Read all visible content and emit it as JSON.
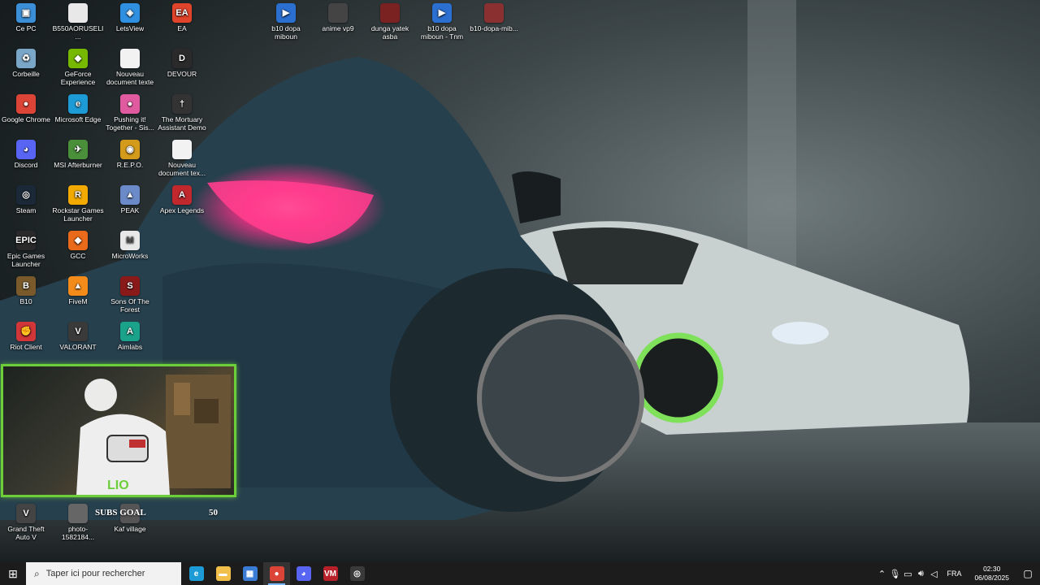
{
  "desktop_icons": [
    {
      "label": "Ce PC",
      "icon": "computer-icon",
      "color": "#3b8fd9",
      "glyph": "▣"
    },
    {
      "label": "B550AORUSELI...",
      "icon": "document-icon",
      "color": "#e8e8e8",
      "glyph": ""
    },
    {
      "label": "LetsView",
      "icon": "letsview-icon",
      "color": "#2f8fe0",
      "glyph": "◈"
    },
    {
      "label": "EA",
      "icon": "ea-icon",
      "color": "#e0442b",
      "glyph": "EA"
    },
    {
      "label": "b10 dopa miboun",
      "icon": "video-file-icon",
      "color": "#2b6fd0",
      "glyph": "▶"
    },
    {
      "label": "anime vp9",
      "icon": "image-file-icon",
      "color": "#444",
      "glyph": ""
    },
    {
      "label": "dunga yatek asba",
      "icon": "image-file-icon",
      "color": "#7a2222",
      "glyph": ""
    },
    {
      "label": "b10 dopa miboun - Tnm",
      "icon": "video-file-icon",
      "color": "#2b6fd0",
      "glyph": "▶"
    },
    {
      "label": "b10-dopa-mib...",
      "icon": "image-file-icon",
      "color": "#8a3030",
      "glyph": ""
    },
    {
      "label": "Corbeille",
      "icon": "recycle-bin-icon",
      "color": "#7aa6c8",
      "glyph": "♻"
    },
    {
      "label": "GeForce Experience",
      "icon": "geforce-icon",
      "color": "#76b900",
      "glyph": "◆"
    },
    {
      "label": "Nouveau document texte",
      "icon": "text-file-icon",
      "color": "#f2f2f2",
      "glyph": ""
    },
    {
      "label": "DEVOUR",
      "icon": "devour-icon",
      "color": "#2a2a2a",
      "glyph": "D"
    },
    {
      "label": "Google Chrome",
      "icon": "chrome-icon",
      "color": "#db4437",
      "glyph": "●"
    },
    {
      "label": "Microsoft Edge",
      "icon": "edge-icon",
      "color": "#1c9bd6",
      "glyph": "e"
    },
    {
      "label": "Pushing it! Together - Sis...",
      "icon": "game-icon",
      "color": "#e05aa0",
      "glyph": "●"
    },
    {
      "label": "The Mortuary Assistant Demo",
      "icon": "mortuary-icon",
      "color": "#333",
      "glyph": "†"
    },
    {
      "label": "Discord",
      "icon": "discord-icon",
      "color": "#5865f2",
      "glyph": "◕"
    },
    {
      "label": "MSI Afterburner",
      "icon": "afterburner-icon",
      "color": "#4a8f3a",
      "glyph": "✈"
    },
    {
      "label": "R.E.P.O.",
      "icon": "repo-icon",
      "color": "#d49a1a",
      "glyph": "◉"
    },
    {
      "label": "Nouveau document tex...",
      "icon": "text-file-icon",
      "color": "#f2f2f2",
      "glyph": ""
    },
    {
      "label": "Steam",
      "icon": "steam-icon",
      "color": "#1b2838",
      "glyph": "◎"
    },
    {
      "label": "Rockstar Games Launcher",
      "icon": "rockstar-icon",
      "color": "#f2a900",
      "glyph": "R"
    },
    {
      "label": "PEAK",
      "icon": "peak-icon",
      "color": "#6a8ac8",
      "glyph": "▲"
    },
    {
      "label": "Apex Legends",
      "icon": "apex-icon",
      "color": "#c0282d",
      "glyph": "A"
    },
    {
      "label": "Epic Games Launcher",
      "icon": "epic-icon",
      "color": "#2a2a2a",
      "glyph": "EPIC"
    },
    {
      "label": "GCC",
      "icon": "gcc-icon",
      "color": "#e86a1a",
      "glyph": "◆"
    },
    {
      "label": "MicroWorks",
      "icon": "microworks-icon",
      "color": "#e8e8e8",
      "glyph": "M"
    },
    {
      "label": "B10",
      "icon": "b10-icon",
      "color": "#7a5a2a",
      "glyph": "B"
    },
    {
      "label": "FiveM",
      "icon": "fivem-icon",
      "color": "#f28b1a",
      "glyph": "▲"
    },
    {
      "label": "Sons Of The Forest",
      "icon": "sotf-icon",
      "color": "#8a1a1a",
      "glyph": "S"
    },
    {
      "label": "Riot Client",
      "icon": "riot-icon",
      "color": "#d13639",
      "glyph": "✊"
    },
    {
      "label": "VALORANT",
      "icon": "valorant-icon",
      "color": "#3a3a3a",
      "glyph": "V"
    },
    {
      "label": "Aimlabs",
      "icon": "aimlabs-icon",
      "color": "#1aa28a",
      "glyph": "A"
    },
    {
      "label": "Grand Theft Auto V",
      "icon": "gta-icon",
      "color": "#444",
      "glyph": "V"
    },
    {
      "label": "photo-1582184...",
      "icon": "photo-icon",
      "color": "#666",
      "glyph": ""
    },
    {
      "label": "Kaf village",
      "icon": "kaf-icon",
      "color": "#555",
      "glyph": ""
    }
  ],
  "overlay": {
    "subs_label": "SUBS GOAL",
    "subs_count": "50",
    "webcam_caption": "LIO"
  },
  "taskbar": {
    "search_placeholder": "Taper ici pour rechercher",
    "apps": [
      {
        "name": "edge",
        "icon": "edge-icon",
        "color": "#1c9bd6",
        "glyph": "e"
      },
      {
        "name": "explorer",
        "icon": "folder-icon",
        "color": "#f2c04a",
        "glyph": "▬"
      },
      {
        "name": "store",
        "icon": "store-icon",
        "color": "#3a7bd5",
        "glyph": "▦"
      },
      {
        "name": "chrome",
        "icon": "chrome-icon",
        "color": "#db4437",
        "glyph": "●"
      },
      {
        "name": "discord",
        "icon": "discord-icon",
        "color": "#5865f2",
        "glyph": "◕"
      },
      {
        "name": "voicemeeter",
        "icon": "voicemeeter-icon",
        "color": "#b8202a",
        "glyph": "VM"
      },
      {
        "name": "afterburner",
        "icon": "afterburner-icon",
        "color": "#3a3a3a",
        "glyph": "◎"
      }
    ],
    "language": "FRA",
    "time": "02:30",
    "date": "06/08/2025"
  }
}
